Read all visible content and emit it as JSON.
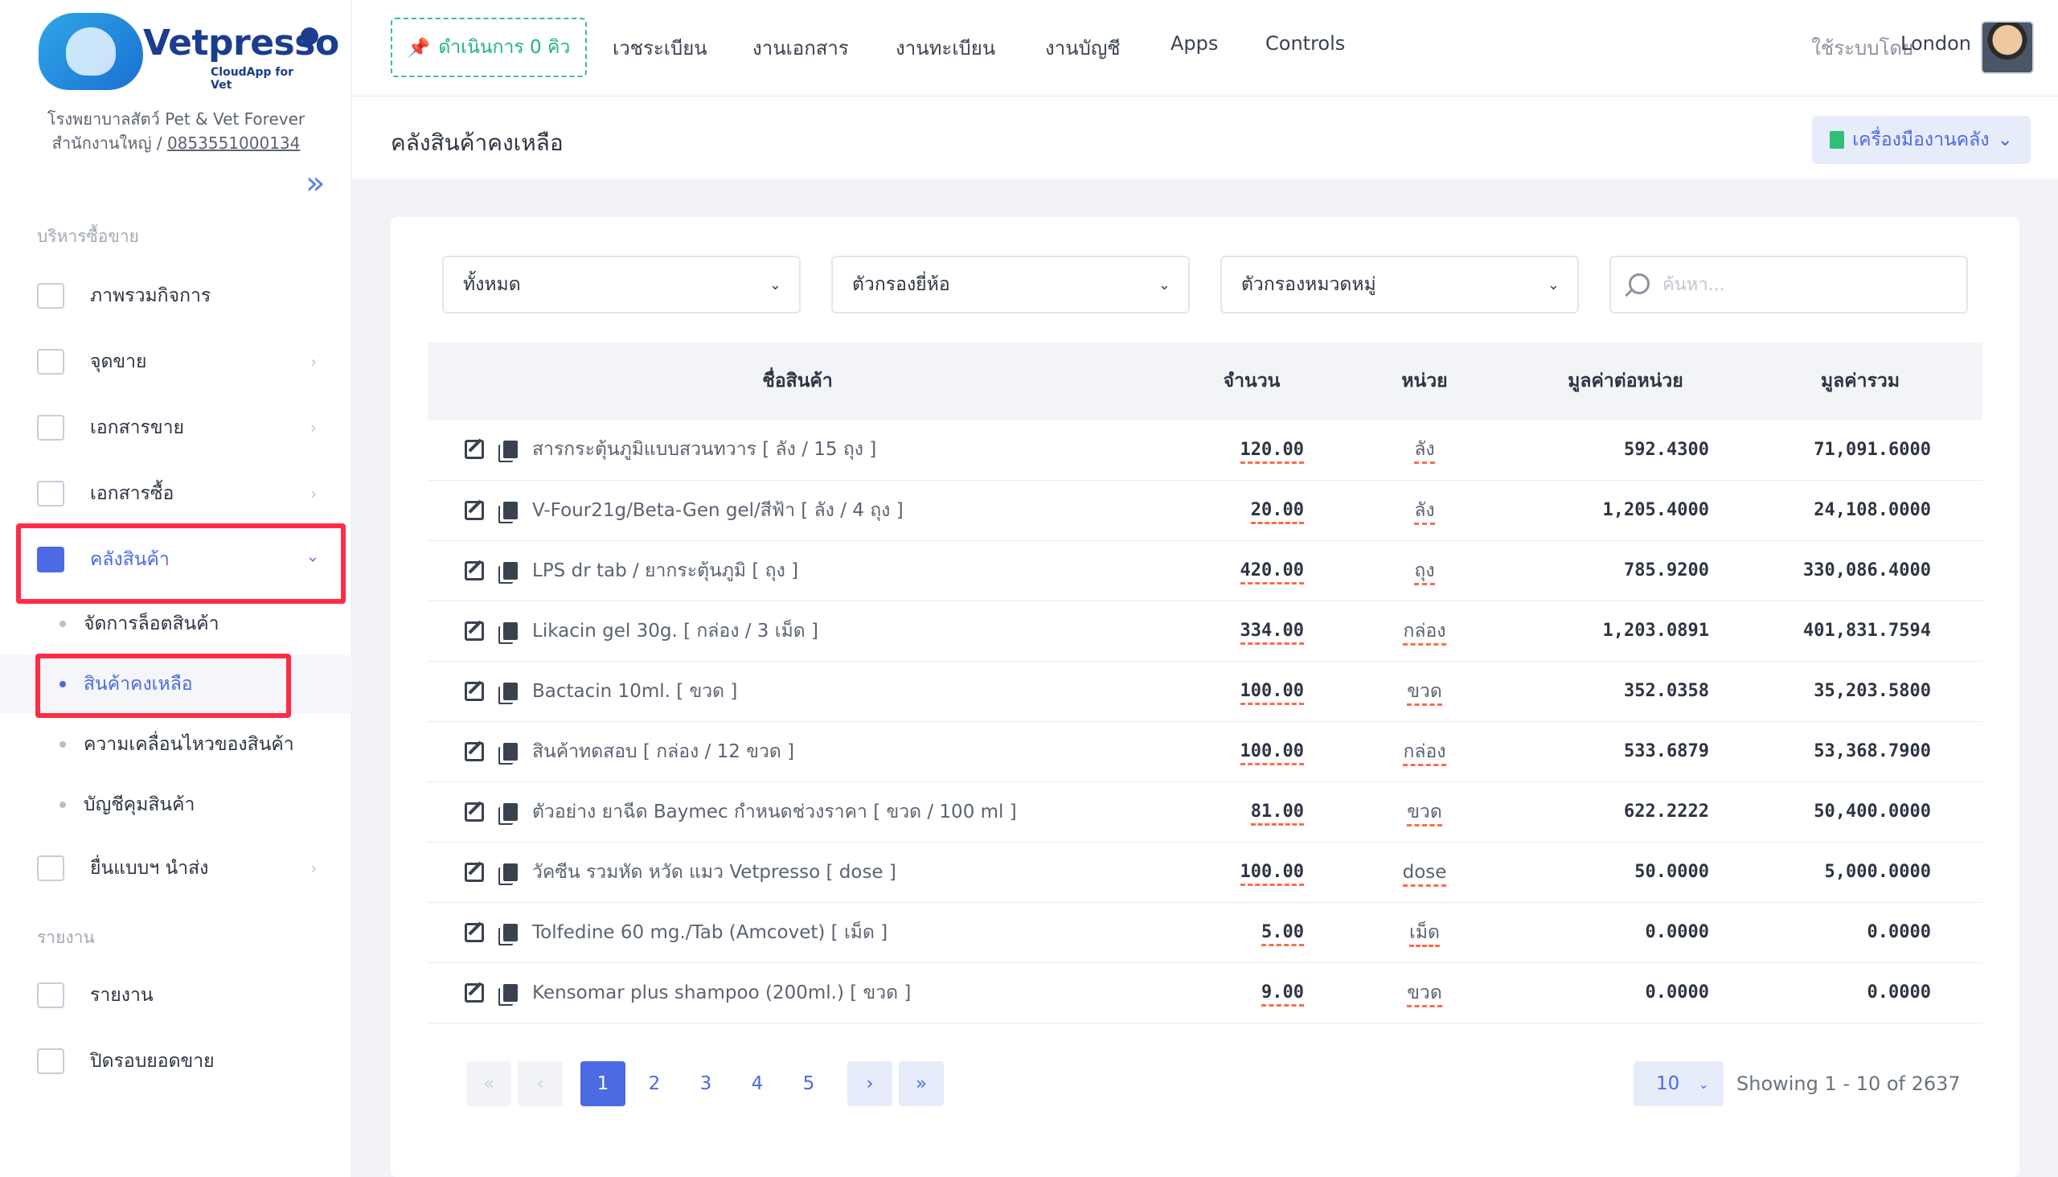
{
  "brand": {
    "logo_text": "Vetpresso",
    "logo_sub": "CloudApp for Vet",
    "clinic_name": "โรงพยาบาลสัตว์ Pet & Vet Forever",
    "branch": "สำนักงานใหญ่ /",
    "phone": "0853551000134"
  },
  "sidebar": {
    "section_sales": "บริหารซื้อขาย",
    "section_reports": "รายงาน",
    "items": [
      {
        "label": "ภาพรวมกิจการ",
        "icon": "chart-doc-icon"
      },
      {
        "label": "จุดขาย",
        "icon": "cash-register-icon"
      },
      {
        "label": "เอกสารขาย",
        "icon": "tag-icon"
      },
      {
        "label": "เอกสารซื้อ",
        "icon": "cart-icon"
      },
      {
        "label": "คลังสินค้า",
        "icon": "warehouse-icon"
      },
      {
        "label": "ยื่นแบบฯ นำส่ง",
        "icon": "folder-icon"
      },
      {
        "label": "รายงาน",
        "icon": "report-icon"
      },
      {
        "label": "ปิดรอบยอดขาย",
        "icon": "clipboard-check-icon"
      }
    ],
    "sub_items": [
      {
        "label": "จัดการล็อตสินค้า"
      },
      {
        "label": "สินค้าคงเหลือ"
      },
      {
        "label": "ความเคลื่อนไหวของสินค้า"
      },
      {
        "label": "บัญชีคุมสินค้า"
      }
    ]
  },
  "topbar": {
    "queue_label": "ดำเนินการ 0 คิว",
    "nav": [
      "เวชระเบียน",
      "งานเอกสาร",
      "งานทะเบียน",
      "งานบัญชี",
      "Apps",
      "Controls"
    ],
    "user_label": "ใช้ระบบโดย",
    "user_name": "London"
  },
  "page": {
    "title": "คลังสินค้าคงเหลือ",
    "tools_label": "เครื่องมืองานคลัง"
  },
  "filters": {
    "status": "ทั้งหมด",
    "brand": "ตัวกรองยี่ห้อ",
    "category": "ตัวกรองหมวดหมู่",
    "search_placeholder": "ค้นหา..."
  },
  "table": {
    "headers": [
      "ชื่อสินค้า",
      "จำนวน",
      "หน่วย",
      "มูลค่าต่อหน่วย",
      "มูลค่ารวม"
    ],
    "rows": [
      {
        "name": "สารกระตุ้นภูมิแบบสวนทวาร [ ลัง / 15 ถุง ]",
        "qty": "120.00",
        "unit": "ลัง",
        "unit_price": "592.4300",
        "total": "71,091.6000"
      },
      {
        "name": "V-Four21g/Beta-Gen gel/สีฟ้า [ ลัง / 4 ถุง ]",
        "qty": "20.00",
        "unit": "ลัง",
        "unit_price": "1,205.4000",
        "total": "24,108.0000"
      },
      {
        "name": "LPS dr tab / ยากระตุ้นภูมิ [ ถุง ]",
        "qty": "420.00",
        "unit": "ถุง",
        "unit_price": "785.9200",
        "total": "330,086.4000"
      },
      {
        "name": "Likacin gel 30g. [ กล่อง / 3 เม็ด ]",
        "qty": "334.00",
        "unit": "กล่อง",
        "unit_price": "1,203.0891",
        "total": "401,831.7594"
      },
      {
        "name": "Bactacin 10ml. [ ขวด ]",
        "qty": "100.00",
        "unit": "ขวด",
        "unit_price": "352.0358",
        "total": "35,203.5800"
      },
      {
        "name": "สินค้าทดสอบ [ กล่อง / 12 ขวด ]",
        "qty": "100.00",
        "unit": "กล่อง",
        "unit_price": "533.6879",
        "total": "53,368.7900"
      },
      {
        "name": "ตัวอย่าง ยาฉีด Baymec กำหนดช่วงราคา [ ขวด / 100 ml ]",
        "qty": "81.00",
        "unit": "ขวด",
        "unit_price": "622.2222",
        "total": "50,400.0000"
      },
      {
        "name": "วัคซีน รวมหัด หวัด แมว Vetpresso [ dose ]",
        "qty": "100.00",
        "unit": "dose",
        "unit_price": "50.0000",
        "total": "5,000.0000"
      },
      {
        "name": "Tolfedine 60 mg./Tab (Amcovet) [ เม็ด ]",
        "qty": "5.00",
        "unit": "เม็ด",
        "unit_price": "0.0000",
        "total": "0.0000"
      },
      {
        "name": "Kensomar plus shampoo (200ml.) [ ขวด ]",
        "qty": "9.00",
        "unit": "ขวด",
        "unit_price": "0.0000",
        "total": "0.0000"
      }
    ]
  },
  "pagination": {
    "first": "«",
    "prev": "‹",
    "pages": [
      "1",
      "2",
      "3",
      "4",
      "5"
    ],
    "current": "1",
    "next": "›",
    "last": "»",
    "per_page": "10",
    "showing": "Showing 1 - 10 of 2637"
  },
  "colors": {
    "accent": "#4b6ae3",
    "highlight_box": "#ff2c46",
    "queue_green": "#22b478"
  }
}
